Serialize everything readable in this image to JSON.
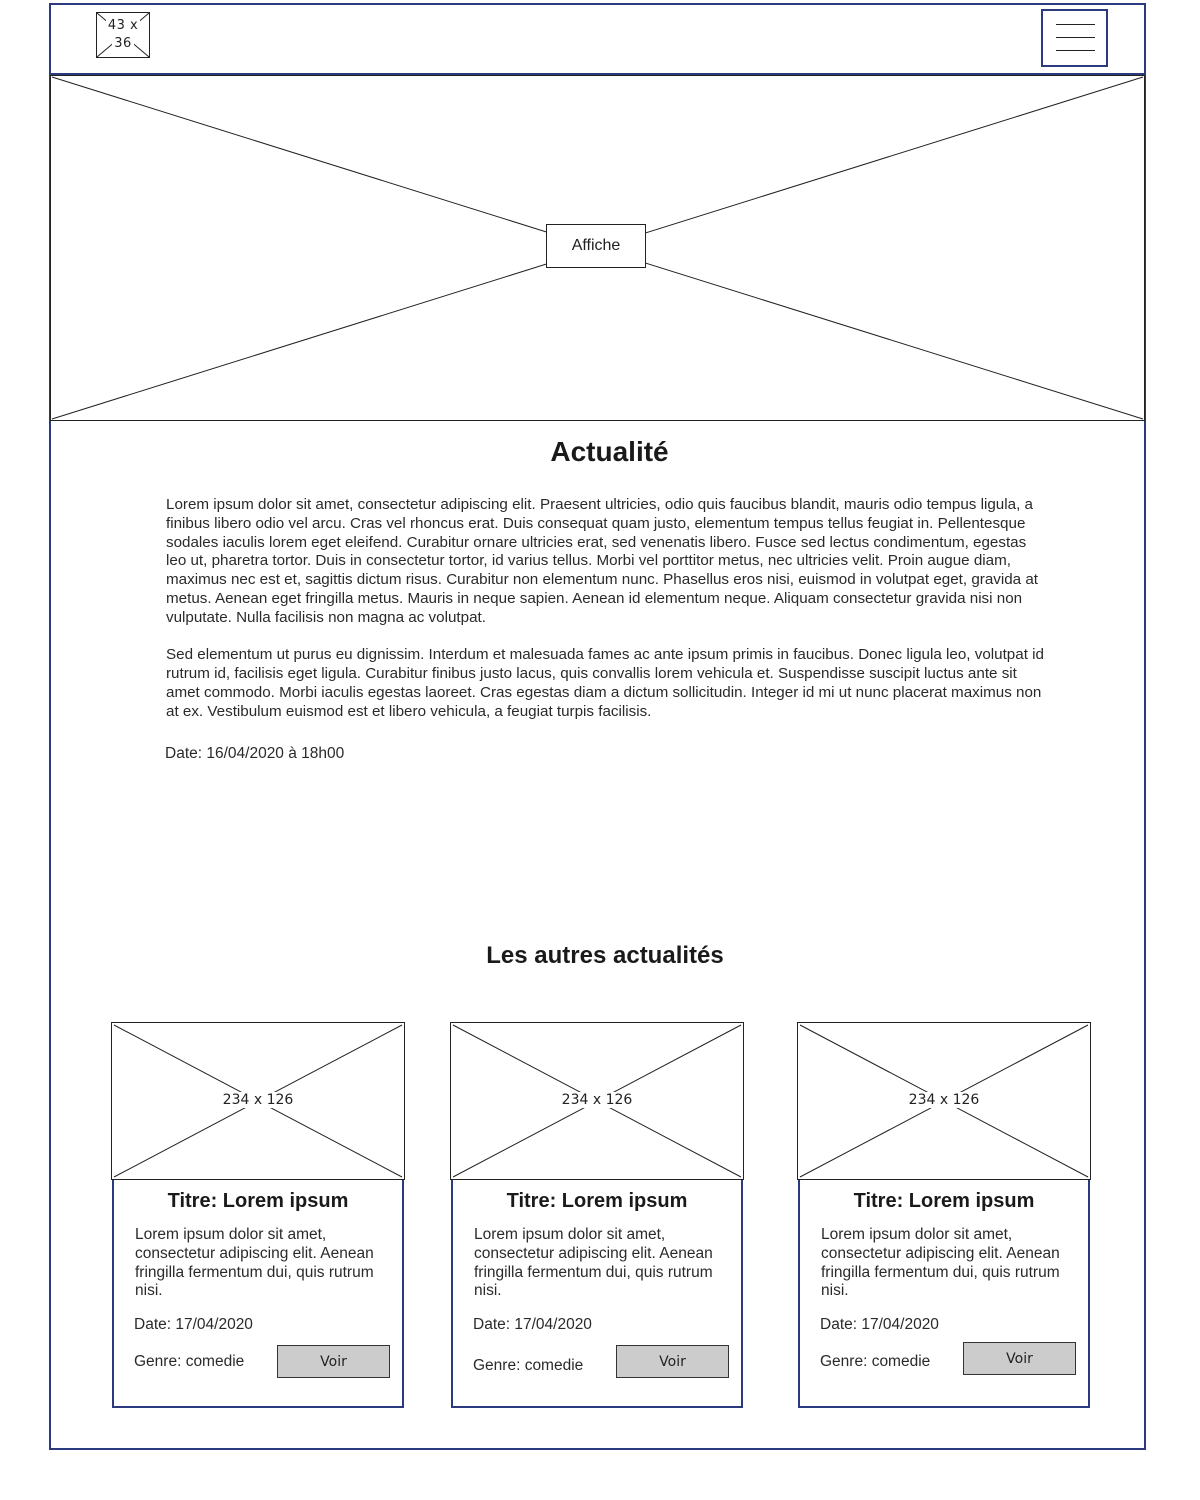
{
  "header": {
    "logo_line1": "43 x",
    "logo_line2": "36"
  },
  "hero": {
    "label": "Affiche"
  },
  "article": {
    "title": "Actualité",
    "paragraph1": "Lorem ipsum dolor sit amet, consectetur adipiscing elit. Praesent ultricies, odio quis faucibus blandit, mauris odio tempus ligula, a finibus libero odio vel arcu. Cras vel rhoncus erat. Duis consequat quam justo, elementum tempus tellus feugiat in. Pellentesque sodales iaculis lorem eget eleifend. Curabitur ornare ultricies erat, sed venenatis libero. Fusce sed lectus condimentum, egestas leo ut, pharetra tortor. Duis in consectetur tortor, id varius tellus. Morbi vel porttitor metus, nec ultricies velit. Proin augue diam, maximus nec est et, sagittis dictum risus. Curabitur non elementum nunc. Phasellus eros nisi, euismod in volutpat eget, gravida at metus. Aenean eget fringilla metus. Mauris in neque sapien. Aenean id elementum neque. Aliquam consectetur gravida nisi non vulputate. Nulla facilisis non magna ac volutpat.",
    "paragraph2": "Sed elementum ut purus eu dignissim. Interdum et malesuada fames ac ante ipsum primis in faucibus. Donec ligula leo, volutpat id rutrum id, facilisis eget ligula. Curabitur finibus justo lacus, quis convallis lorem vehicula et. Suspendisse suscipit luctus ante sit amet commodo. Morbi iaculis egestas laoreet. Cras egestas diam a dictum sollicitudin. Integer id mi ut nunc placerat maximus non at ex. Vestibulum euismod est et libero vehicula, a feugiat turpis facilisis.",
    "date": "Date: 16/04/2020 à 18h00"
  },
  "others": {
    "title": "Les autres actualités",
    "cards": [
      {
        "image_label": "234 x 126",
        "title": "Titre: Lorem ipsum",
        "text": "Lorem ipsum dolor sit amet, consectetur adipiscing elit. Aenean fringilla fermentum dui, quis rutrum nisi.",
        "date": "Date: 17/04/2020",
        "genre": "Genre: comedie",
        "button": "Voir"
      },
      {
        "image_label": "234 x 126",
        "title": "Titre: Lorem ipsum",
        "text": "Lorem ipsum dolor sit amet, consectetur adipiscing elit. Aenean fringilla fermentum dui, quis rutrum nisi.",
        "date": "Date: 17/04/2020",
        "genre": "Genre: comedie",
        "button": "Voir"
      },
      {
        "image_label": "234 x 126",
        "title": "Titre: Lorem ipsum",
        "text": "Lorem ipsum dolor sit amet, consectetur adipiscing elit. Aenean fringilla fermentum dui, quis rutrum nisi.",
        "date": "Date: 17/04/2020",
        "genre": "Genre: comedie",
        "button": "Voir"
      }
    ]
  },
  "colors": {
    "frame_border": "#2b3a7e",
    "button_bg": "#cccccc"
  }
}
